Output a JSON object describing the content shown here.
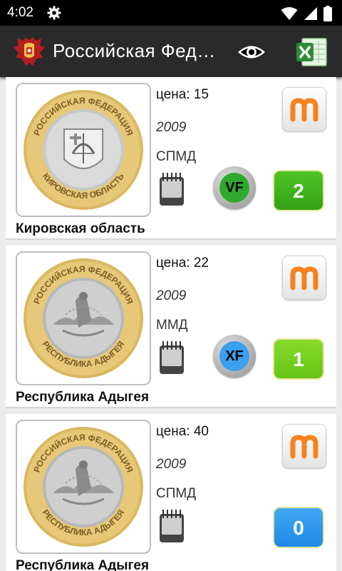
{
  "status_bar": {
    "time": "4:02",
    "icons": [
      "gear-icon",
      "wifi-icon",
      "signal-icon",
      "battery-icon"
    ]
  },
  "app_bar": {
    "title": "Российская Фед…",
    "icons": [
      "emblem-icon",
      "eye-icon",
      "excel-icon"
    ]
  },
  "colors": {
    "statusbar": "#000000",
    "appbar": "#2a2a2a",
    "count_green": "#3db51b",
    "count_lightgreen": "#74d21e",
    "count_blue": "#2196f3",
    "grade_vf": "#2eaa2e",
    "grade_xf": "#3aa0f0",
    "m_orange": "#f5821f"
  },
  "coins": [
    {
      "price": "цена: 15",
      "year": "2009",
      "mint": "СПМД",
      "name": "Кировская область",
      "grade": "VF",
      "count": "2",
      "legend_top": "РОССИЙСКАЯ ФЕДЕРАЦИЯ",
      "legend_bottom": "КИРОВСКАЯ ОБЛАСТЬ"
    },
    {
      "price": "цена: 22",
      "year": "2009",
      "mint": "ММД",
      "name": "Республика Адыгея",
      "grade": "XF",
      "count": "1",
      "legend_top": "РОССИЙСКАЯ ФЕДЕРАЦИЯ",
      "legend_bottom": "РЕСПУБЛИКА АДЫГЕЯ"
    },
    {
      "price": "цена: 40",
      "year": "2009",
      "mint": "СПМД",
      "name": "Республика Адыгея",
      "grade": "",
      "count": "0",
      "legend_top": "РОССИЙСКАЯ ФЕДЕРАЦИЯ",
      "legend_bottom": "РЕСПУБЛИКА АДЫГЕЯ"
    }
  ]
}
